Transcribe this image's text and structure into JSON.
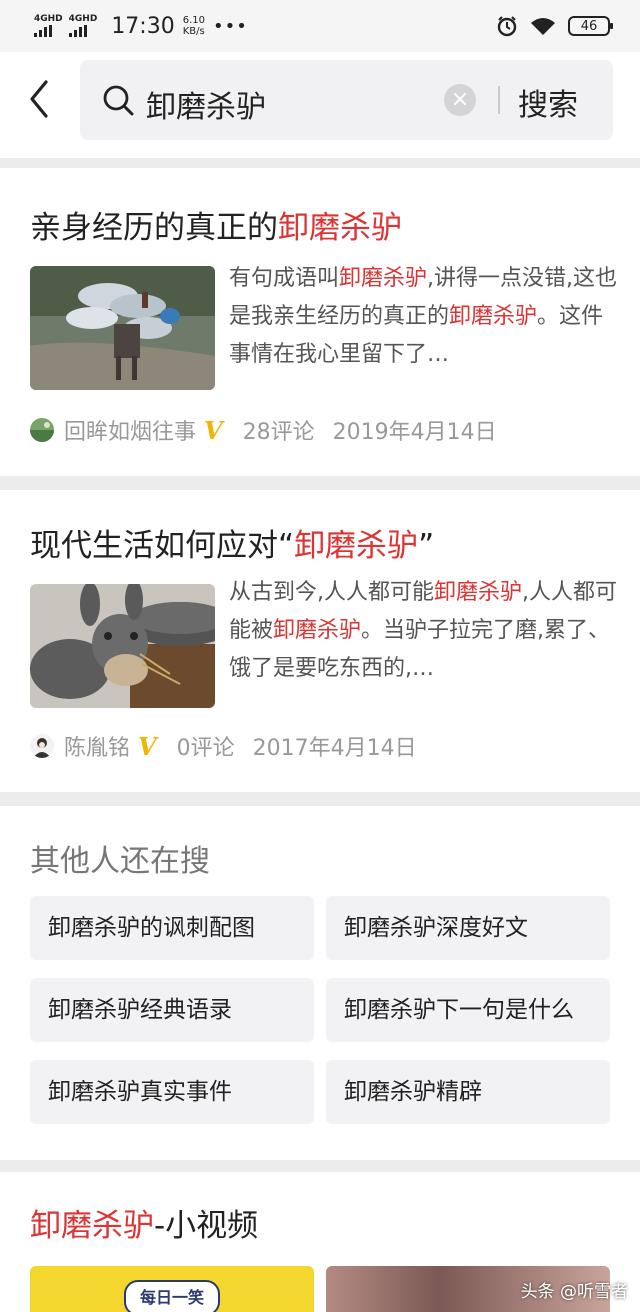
{
  "status_bar": {
    "signal1_label": "4GHD",
    "signal2_label": "4GHD",
    "time": "17:30",
    "speed_value": "6.10",
    "speed_unit": "KB/s",
    "more": "•••",
    "battery": "46"
  },
  "search": {
    "query": "卸磨杀驴",
    "submit_label": "搜索"
  },
  "results": [
    {
      "title_pre": "亲身经历的真正的",
      "title_hl": "卸磨杀驴",
      "title_post": "",
      "snippet_parts": [
        {
          "t": "有句成语叫",
          "hl": false
        },
        {
          "t": "卸磨杀驴",
          "hl": true
        },
        {
          "t": ",讲得一点没错,这也是我亲生经历的真正的",
          "hl": false
        },
        {
          "t": "卸磨杀驴",
          "hl": true
        },
        {
          "t": "。这件事情在我心里留下了…",
          "hl": false
        }
      ],
      "author": "回眸如烟往事",
      "verified": "V",
      "comments": "28评论",
      "date": "2019年4月14日"
    },
    {
      "title_pre": "现代生活如何应对“",
      "title_hl": "卸磨杀驴",
      "title_post": "”",
      "snippet_parts": [
        {
          "t": "从古到今,人人都可能",
          "hl": false
        },
        {
          "t": "卸磨杀驴",
          "hl": true
        },
        {
          "t": ",人人都可能被",
          "hl": false
        },
        {
          "t": "卸磨杀驴",
          "hl": true
        },
        {
          "t": "。当驴子拉完了磨,累了、饿了是要吃东西的,…",
          "hl": false
        }
      ],
      "author": "陈胤铭",
      "verified": "V",
      "comments": "0评论",
      "date": "2017年4月14日"
    }
  ],
  "related": {
    "title": "其他人还在搜",
    "items": [
      "卸磨杀驴的讽刺配图",
      "卸磨杀驴深度好文",
      "卸磨杀驴经典语录",
      "卸磨杀驴下一句是什么",
      "卸磨杀驴真实事件",
      "卸磨杀驴精辟"
    ]
  },
  "video": {
    "title_hl": "卸磨杀驴",
    "title_rest": "-小视频",
    "thumb1_badge": "每日一笑"
  },
  "watermark": "头条 @听雪者",
  "colors": {
    "highlight": "#dd3333",
    "verified": "#f2b600"
  }
}
